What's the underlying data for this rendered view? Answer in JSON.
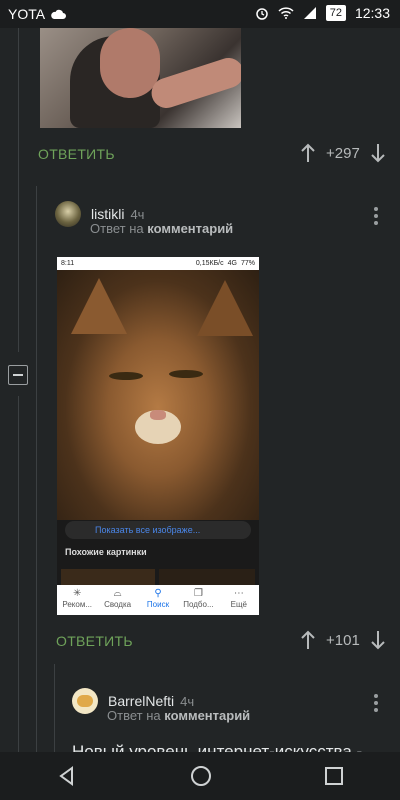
{
  "status_bar": {
    "carrier": "YOTA",
    "battery": "72",
    "time": "12:33"
  },
  "comment_1": {
    "reply_label": "ОТВЕТИТЬ",
    "score": "+297"
  },
  "comment_2": {
    "username": "listikli",
    "time": "4ч",
    "reply_to_prefix": "Ответ на",
    "reply_to_target": "комментарий",
    "reply_label": "ОТВЕТИТЬ",
    "score": "+101",
    "screenshot": {
      "status_time": "8:11",
      "status_right": "0,15КБ/с",
      "network": "4G",
      "battery": "77%",
      "show_all_link": "Показать все изображе...",
      "similar_heading": "Похожие картинки",
      "tabs": [
        "Реком...",
        "Сводка",
        "Поиск",
        "Подбо...",
        "Ещё"
      ]
    }
  },
  "comment_3": {
    "username": "BarrelNefti",
    "time": "4ч",
    "reply_to_prefix": "Ответ на",
    "reply_to_target": "комментарий",
    "text": "Новый уровень интернет-искусства -"
  }
}
